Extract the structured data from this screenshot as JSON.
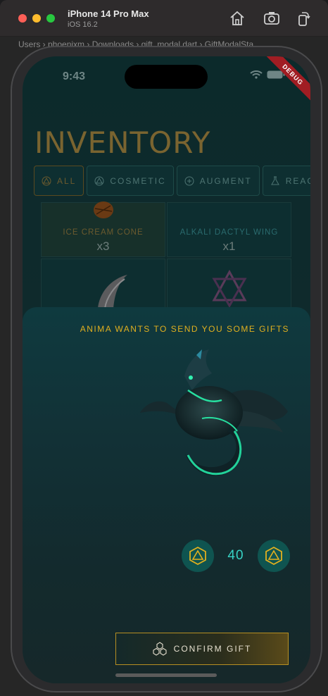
{
  "window": {
    "device_name": "iPhone 14 Pro Max",
    "os_version": "iOS 16.2",
    "ide_breadcrumb": "Users › phoenixm › Downloads › gift_modal.dart › GiftModalSta"
  },
  "status_bar": {
    "time": "9:43",
    "debug_label": "DEBUG"
  },
  "inventory": {
    "title": "INVENTORY",
    "tabs": [
      {
        "label": "ALL"
      },
      {
        "label": "COSMETIC"
      },
      {
        "label": "AUGMENT"
      },
      {
        "label": "REAG"
      }
    ],
    "items": [
      {
        "name": "ICE CREAM CONE",
        "qty": "x3"
      },
      {
        "name": "ALKALI DACTYL WING",
        "qty": "x1"
      }
    ]
  },
  "gift_modal": {
    "heading": "ANIMA WANTS TO SEND YOU SOME GIFTS",
    "amount": "40",
    "confirm_label": "CONFIRM GIFT"
  },
  "colors": {
    "accent_gold": "#e1b01f",
    "accent_teal": "#37d2c4",
    "modal_bg": "#123136"
  }
}
